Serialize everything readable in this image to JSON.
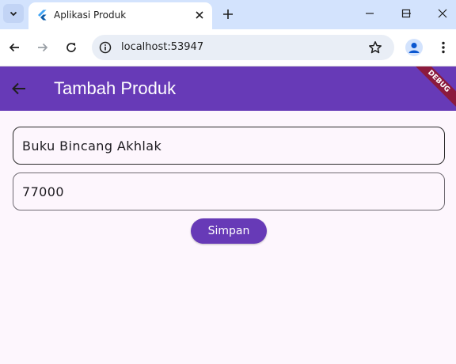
{
  "browser": {
    "tab_title": "Aplikasi Produk",
    "url": "localhost:53947"
  },
  "app": {
    "title": "Tambah Produk",
    "debug_label": "DEBUG",
    "primary_color": "#673ab7"
  },
  "form": {
    "name_value": "Buku Bincang Akhlak",
    "price_value": "77000",
    "save_label": "Simpan"
  }
}
